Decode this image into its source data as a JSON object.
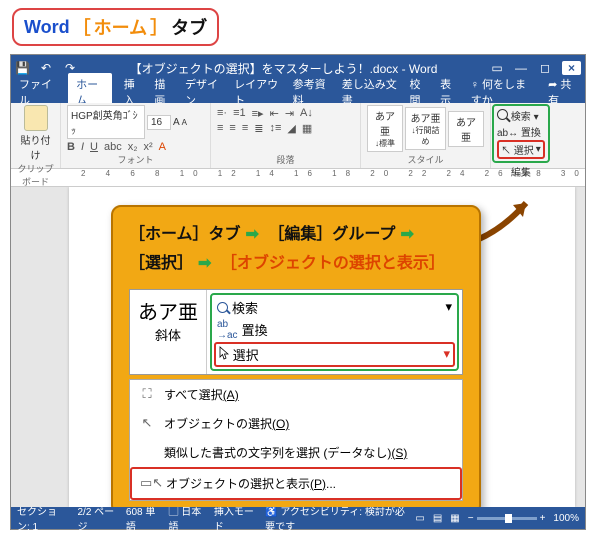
{
  "callout": {
    "t1": "Word",
    "b1": "［",
    "t2": "ホーム",
    "b2": "］",
    "t3": "タブ"
  },
  "titlebar": {
    "title": "【オブジェクトの選択】をマスターしよう！.docx  -  Word"
  },
  "menu": {
    "file": "ファイル",
    "home": "ホーム",
    "insert": "挿入",
    "draw": "描画",
    "design": "デザイン",
    "layout": "レイアウト",
    "ref": "参考資料",
    "mail": "差し込み文書",
    "review": "校閲",
    "view": "表示",
    "tell": "何をしますか",
    "share": "共有"
  },
  "ribbon": {
    "paste": "貼り付け",
    "clipboard": "クリップボード",
    "font_name": "HGP創英角ｺﾞｼｯ",
    "font_size": "16",
    "font_lbl": "フォント",
    "para_lbl": "段落",
    "style1": "あア亜",
    "style2": "あア亜",
    "style3": "あア亜",
    "style_sub1": "↓標準",
    "style_sub2": "↓行間詰め",
    "styles": "スタイル",
    "search": "検索",
    "replace": "置換",
    "select": "選択",
    "edit": "編集"
  },
  "panel": {
    "l1a": "［ホーム］タブ",
    "l1b": "［編集］グループ",
    "l2a": "［選択］",
    "l2b": "［オブジェクトの選択と表示］",
    "aa": "あア亜",
    "italic": "斜体",
    "search": "検索",
    "replace": "置換",
    "select": "選択",
    "m1": "すべて選択",
    "m1k": "(A)",
    "m2": "オブジェクトの選択",
    "m2k": "(O)",
    "m3": "類似した書式の文字列を選択 (データなし)",
    "m3k": "(S)",
    "m4": "オブジェクトの選択と表示",
    "m4k": "(P)",
    "m4e": "..."
  },
  "status": {
    "section": "セクション: 1",
    "page": "2/2 ページ",
    "words": "608 単語",
    "lang": "日本語",
    "mode": "挿入モード",
    "ax": "アクセシビリティ: 検討が必要です",
    "zoom": "100%"
  }
}
